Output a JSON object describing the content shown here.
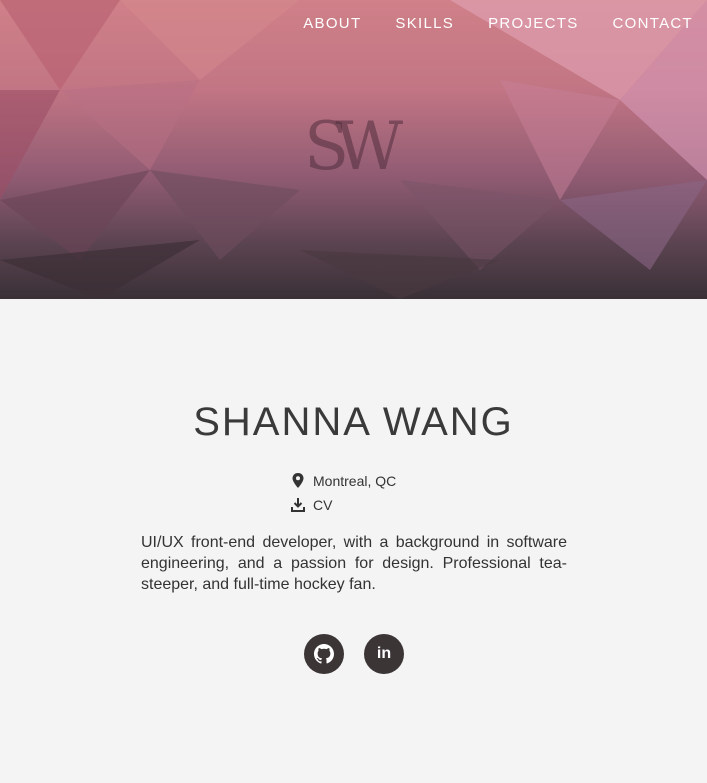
{
  "nav": {
    "items": [
      "ABOUT",
      "SKILLS",
      "PROJECTS",
      "CONTACT"
    ]
  },
  "logo": "SW",
  "profile": {
    "name": "SHANNA WANG",
    "location": "Montreal, QC",
    "cv": "CV",
    "bio": "UI/UX front-end developer, with a background in software engineering, and a passion for design. Professional tea-steeper, and full-time hockey fan."
  },
  "social": [
    {
      "icon": "github-icon"
    },
    {
      "icon": "linkedin-icon",
      "label": "in"
    }
  ],
  "colors": {
    "hero_top": "#cf8088",
    "hero_bottom": "#3a3036",
    "button": "#3b3536",
    "background": "#f4f4f4"
  }
}
